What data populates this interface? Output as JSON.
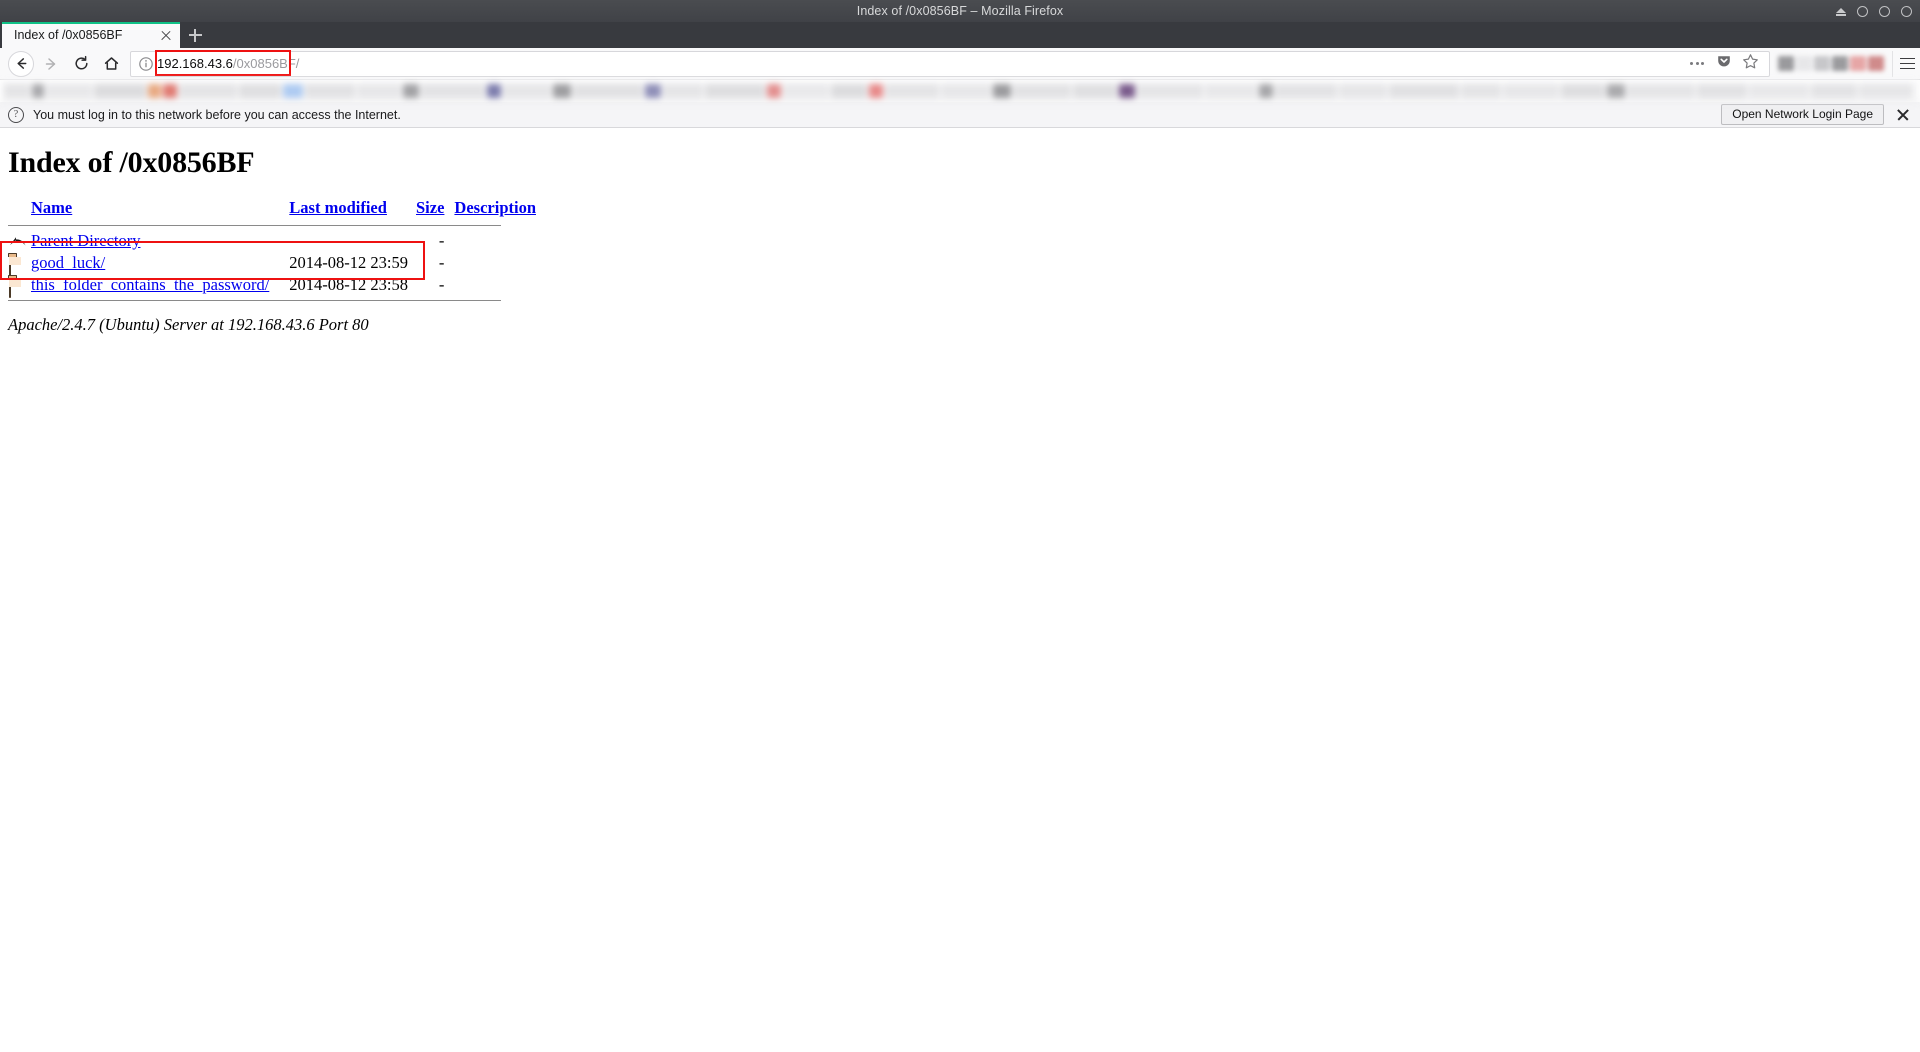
{
  "window": {
    "title": "Index of /0x0856BF – Mozilla Firefox",
    "controls": {
      "eject": "eject-icon",
      "minimize": "minimize-circle",
      "maximize": "maximize-circle",
      "close": "close-circle"
    }
  },
  "tabs": {
    "items": [
      {
        "title": "Index of /0x0856BF",
        "close_label": "×"
      }
    ],
    "new_tab_label": "+"
  },
  "toolbar": {
    "back_label": "←",
    "forward_label": "→",
    "reload_label": "⟳",
    "home_label": "⌂",
    "page_actions_label": "•••",
    "pocket_label": "pocket",
    "bookmark_label": "☆",
    "menu_label": "≡"
  },
  "urlbar": {
    "identity_icon": "info-circle-icon",
    "host": "192.168.43.6",
    "path": "/0x0856BF/",
    "full_url": "192.168.43.6/0x0856BF/",
    "highlight_color": "#ee1111"
  },
  "notification": {
    "icon": "?",
    "message": "You must log in to this network before you can access the Internet.",
    "button_label": "Open Network Login Page",
    "close_label": "×"
  },
  "page": {
    "title": "Index of /0x0856BF",
    "columns": {
      "icon": "",
      "name": "Name",
      "last_modified": "Last modified",
      "size": "Size",
      "description": "Description"
    },
    "rows": [
      {
        "icon": "back-arrow-icon",
        "name": "Parent Directory",
        "last_modified": "",
        "size": "-",
        "description": ""
      },
      {
        "icon": "folder-icon",
        "name": "good_luck/",
        "last_modified": "2014-08-12 23:59",
        "size": "-",
        "description": ""
      },
      {
        "icon": "folder-icon",
        "name": "this_folder_contains_the_password/",
        "last_modified": "2014-08-12 23:58",
        "size": "-",
        "description": ""
      }
    ],
    "footer": "Apache/2.4.7 (Ubuntu) Server at 192.168.43.6 Port 80",
    "annotation_color": "#ee1111"
  }
}
